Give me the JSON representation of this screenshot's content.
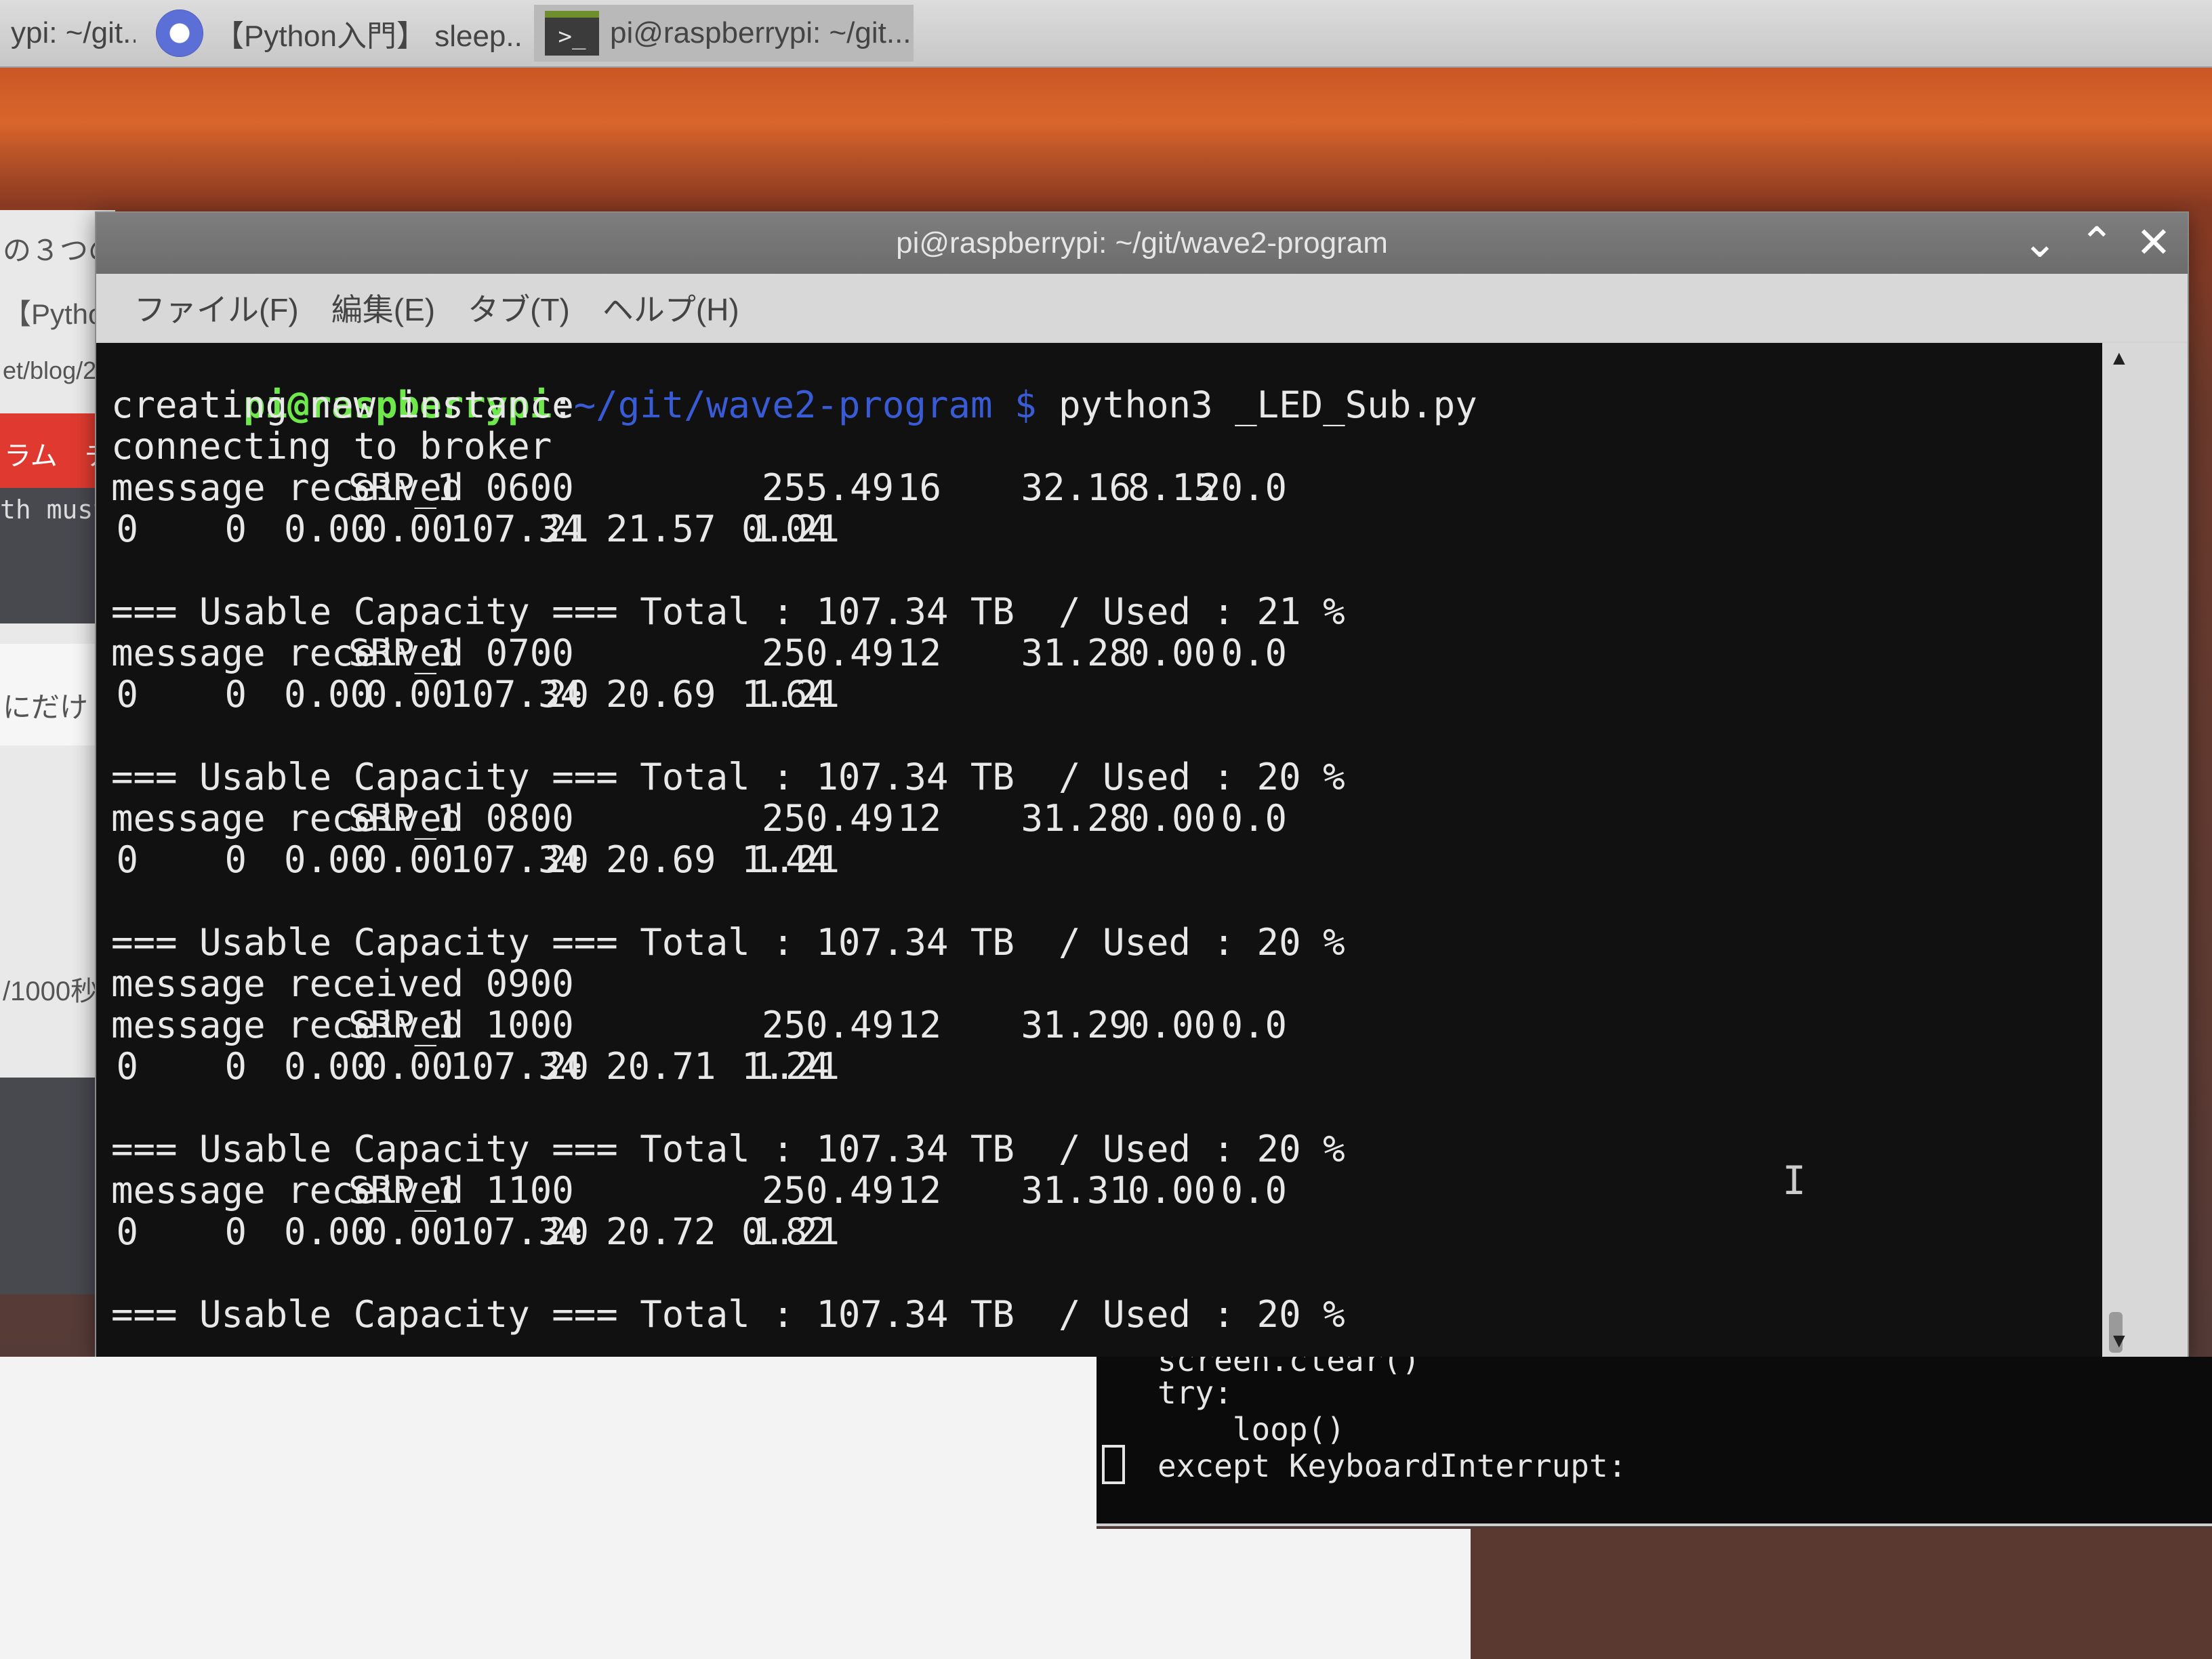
{
  "taskbar": {
    "items": [
      {
        "label": "ypi: ~/git..."
      },
      {
        "label": "【Python入門】 sleep..."
      },
      {
        "label": "pi@raspberrypi: ~/git..."
      }
    ]
  },
  "background_window": {
    "lines": [
      "の３つの",
      "【Pytho",
      "et/blog/2",
      "ラム　チ",
      "th must",
      "にだけ",
      "/1000秒"
    ]
  },
  "window": {
    "title": "pi@raspberrypi: ~/git/wave2-program",
    "menu": [
      "ファイル(F)",
      "編集(E)",
      "タブ(T)",
      "ヘルプ(H)"
    ]
  },
  "terminal": {
    "prompt_user": "pi@raspberrypi",
    "prompt_sep": ":",
    "prompt_path": "~/git/wave2-program $",
    "command": "python3 _LED_Sub.py",
    "lines": [
      "creating new instance",
      "connecting to broker"
    ],
    "blocks": [
      {
        "msg": "message received 0600",
        "srp": "SRP_1",
        "r1": [
          "255.49",
          "16",
          "32.16",
          "8.15",
          "20.0"
        ],
        "r2": [
          "0",
          "0",
          "0.00",
          "0.00",
          "107.34",
          "21",
          "21.57",
          "1.21",
          "0.04"
        ],
        "cap": "=== Usable Capacity === Total : 107.34 TB  / Used : 21 %"
      },
      {
        "msg": "message received 0700",
        "srp": "SRP_1",
        "r1": [
          "250.49",
          "12",
          "31.28",
          "0.00",
          "0.0"
        ],
        "r2": [
          "0",
          "0",
          "0.00",
          "0.00",
          "107.34",
          "20",
          "20.69",
          "1.21",
          "1.64"
        ],
        "cap": "=== Usable Capacity === Total : 107.34 TB  / Used : 20 %"
      },
      {
        "msg": "message received 0800",
        "srp": "SRP_1",
        "r1": [
          "250.49",
          "12",
          "31.28",
          "0.00",
          "0.0"
        ],
        "r2": [
          "0",
          "0",
          "0.00",
          "0.00",
          "107.34",
          "20",
          "20.69",
          "1.21",
          "1.44"
        ],
        "cap": "=== Usable Capacity === Total : 107.34 TB  / Used : 20 %"
      },
      {
        "pre": "message received 0900",
        "msg": "message received 1000",
        "srp": "SRP_1",
        "r1": [
          "250.49",
          "12",
          "31.29",
          "0.00",
          "0.0"
        ],
        "r2": [
          "0",
          "0",
          "0.00",
          "0.00",
          "107.34",
          "20",
          "20.71",
          "1.21",
          "1.24"
        ],
        "cap": "=== Usable Capacity === Total : 107.34 TB  / Used : 20 %"
      },
      {
        "msg": "message received 1100",
        "srp": "SRP_1",
        "r1": [
          "250.49",
          "12",
          "31.31",
          "0.00",
          "0.0"
        ],
        "r2": [
          "0",
          "0",
          "0.00",
          "0.00",
          "107.34",
          "20",
          "20.72",
          "1.21",
          "0.82"
        ],
        "cap": "=== Usable Capacity === Total : 107.34 TB  / Used : 20 %"
      }
    ]
  },
  "code_window": {
    "lines": [
      "screen.clear()",
      "try:",
      "    loop()",
      "except KeyboardInterrupt:"
    ]
  },
  "icons": {
    "minimize": "chevron-down-icon",
    "maximize": "chevron-up-icon",
    "close": "close-icon"
  }
}
